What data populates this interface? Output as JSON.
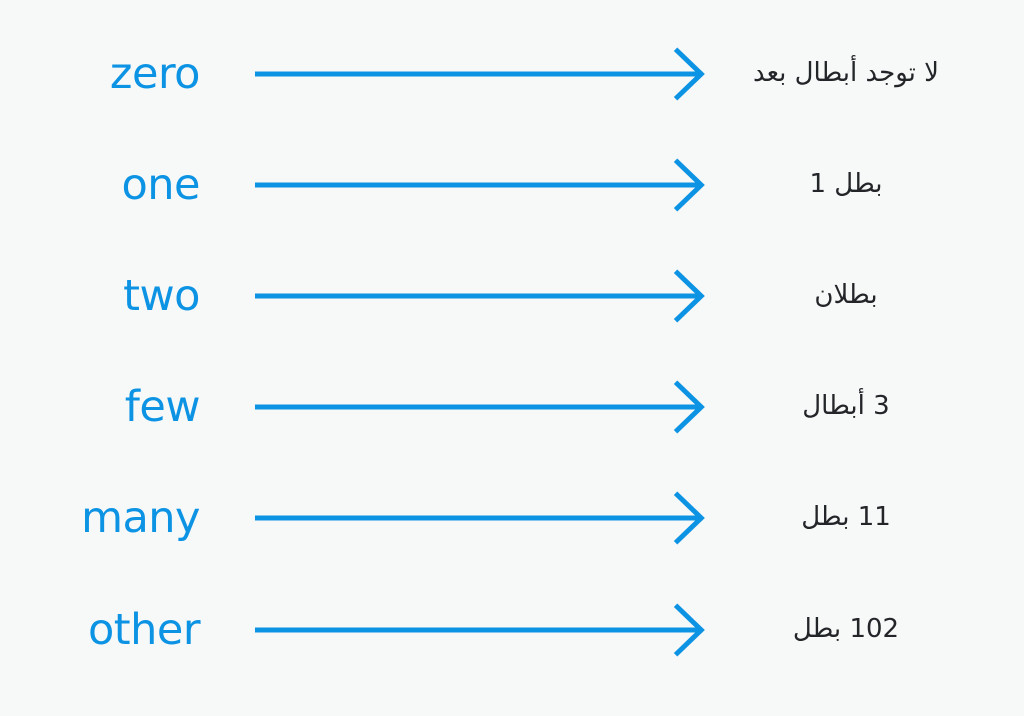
{
  "diagram": {
    "type": "plural-category-mapping",
    "background_color": "#f7f8f8",
    "arrow_color": "#0c93e4",
    "category_color": "#0c93e4",
    "translation_color": "#232629",
    "language": "Arabic",
    "arrow_icon_name": "right-arrow-icon",
    "rows": [
      {
        "category": "zero",
        "translation": "لا توجد أبطال بعد",
        "arrow": "→"
      },
      {
        "category": "one",
        "translation": "بطل 1",
        "arrow": "→"
      },
      {
        "category": "two",
        "translation": "بطلان",
        "arrow": "→"
      },
      {
        "category": "few",
        "translation": "3 أبطال",
        "arrow": "→"
      },
      {
        "category": "many",
        "translation": "11 بطل",
        "arrow": "→"
      },
      {
        "category": "other",
        "translation": "102 بطل",
        "arrow": "→"
      }
    ]
  }
}
